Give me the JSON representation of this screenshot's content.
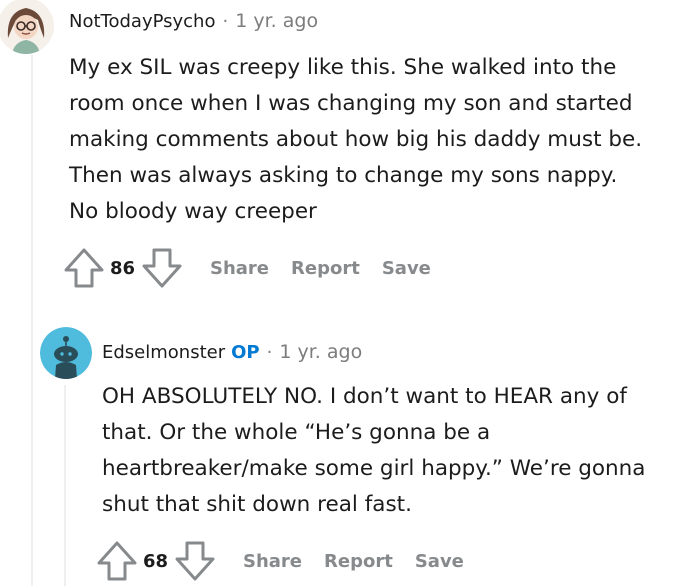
{
  "comments": [
    {
      "username": "NotTodayPsycho",
      "separator": "·",
      "time": "1 yr. ago",
      "avatar_icon": "girl-with-glasses-avatar-icon",
      "body_lines": [
        "My ex SIL was creepy like this. She walked into the",
        "room once when I was changing my son and started",
        "making comments about how big his daddy must be.",
        "Then was always asking to change my sons nappy.",
        "No bloody way creeper"
      ],
      "score": "86",
      "actions": {
        "share": "Share",
        "report": "Report",
        "save": "Save"
      }
    },
    {
      "username": "Edselmonster",
      "op_badge": "OP",
      "separator": "·",
      "time": "1 yr. ago",
      "avatar_icon": "snoo-avatar-icon",
      "avatar_color": "#4fbcdd",
      "body_lines": [
        "OH ABSOLUTELY NO. I don’t want to HEAR any of",
        "that. Or the whole “He’s gonna be a",
        "heartbreaker/make some girl happy.” We’re gonna",
        "shut that shit down real fast."
      ],
      "score": "68",
      "actions": {
        "share": "Share",
        "report": "Report",
        "save": "Save"
      }
    }
  ],
  "colors": {
    "op_badge": "#0079d3",
    "meta_text": "#7c7c7c",
    "action_text": "#878a8c",
    "thread_line": "#edeff1"
  }
}
